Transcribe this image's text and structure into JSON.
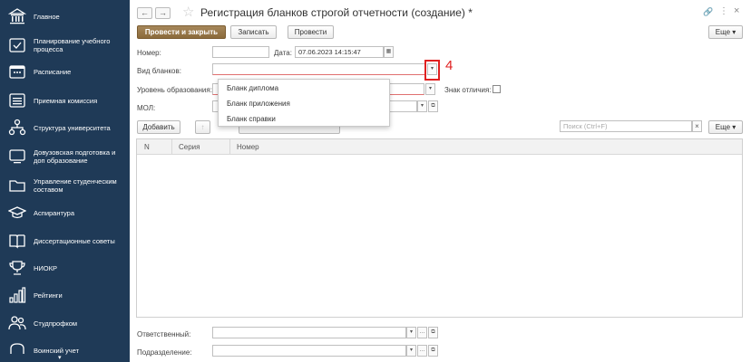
{
  "sidebar": {
    "items": [
      {
        "label": "Главное",
        "icon": "building-icon"
      },
      {
        "label": "Планирование учебного процесса",
        "icon": "checklist-icon"
      },
      {
        "label": "Расписание",
        "icon": "calendar-icon"
      },
      {
        "label": "Приемная комиссия",
        "icon": "list-icon"
      },
      {
        "label": "Структура университета",
        "icon": "structure-icon"
      },
      {
        "label": "Довузовская подготовка и доп образование",
        "icon": "monitor-icon"
      },
      {
        "label": "Управление студенческим составом",
        "icon": "folder-icon"
      },
      {
        "label": "Аспирантура",
        "icon": "graduation-cap-icon"
      },
      {
        "label": "Диссертационные советы",
        "icon": "book-icon"
      },
      {
        "label": "НИОКР",
        "icon": "trophy-icon"
      },
      {
        "label": "Рейтинги",
        "icon": "bar-chart-icon"
      },
      {
        "label": "Студпрофком",
        "icon": "people-icon"
      },
      {
        "label": "Воинский учет",
        "icon": "shield-icon"
      }
    ],
    "scroll_down": "▾"
  },
  "header": {
    "back": "←",
    "forward": "→",
    "star": "☆",
    "title": "Регистрация бланков строгой отчетности (создание) *",
    "link_icon": "🔗",
    "more_dots": "⋮",
    "close": "×"
  },
  "toolbar": {
    "post_close": "Провести и закрыть",
    "save": "Записать",
    "post": "Провести",
    "more": "Еще ▾"
  },
  "form": {
    "number_label": "Номер:",
    "number_value": "",
    "date_label": "Дата:",
    "date_value": "07.06.2023 14:15:47",
    "blank_type_label": "Вид бланков:",
    "blank_type_value": "",
    "edu_level_label": "Уровень образования:",
    "distinction_label": "Знак отличия:",
    "mol_label": "МОЛ:"
  },
  "dropdown": {
    "options": [
      "Бланк диплома",
      "Бланк приложения",
      "Бланк справки"
    ]
  },
  "annotation": {
    "step": "4"
  },
  "table_toolbar": {
    "add": "Добавить",
    "up": "↑",
    "search_placeholder": "Поиск (Ctrl+F)",
    "clear": "×",
    "more": "Еще ▾"
  },
  "table": {
    "columns": [
      "N",
      "Серия",
      "Номер"
    ]
  },
  "footer": {
    "responsible_label": "Ответственный:",
    "department_label": "Подразделение:"
  },
  "colors": {
    "sidebar_bg": "#1f3a57",
    "primary_button": "#8b6a3b",
    "annotation": "#e02020"
  }
}
